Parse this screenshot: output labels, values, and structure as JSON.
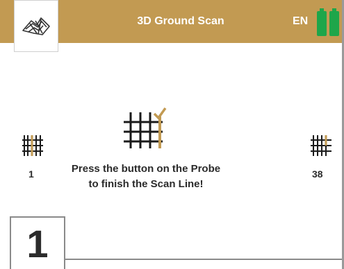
{
  "header": {
    "title": "3D Ground Scan",
    "language": "EN",
    "logo_icon": "terrain-scan-icon",
    "battery_icons": [
      "battery-full-icon",
      "battery-full-icon"
    ]
  },
  "scan": {
    "message": "Press the button on the Probe to finish the Scan Line!",
    "current_line_number": "1",
    "total_line_number": "38",
    "center_icon": "scan-grid-checkmark-icon",
    "left_icon": "scan-grid-first-line-icon",
    "right_icon": "scan-grid-last-line-icon"
  },
  "step": {
    "number": "1"
  },
  "colors": {
    "header_bg": "#c29a52",
    "accent": "#c29a52",
    "battery": "#1ea64a",
    "text": "#2b2b2b"
  }
}
